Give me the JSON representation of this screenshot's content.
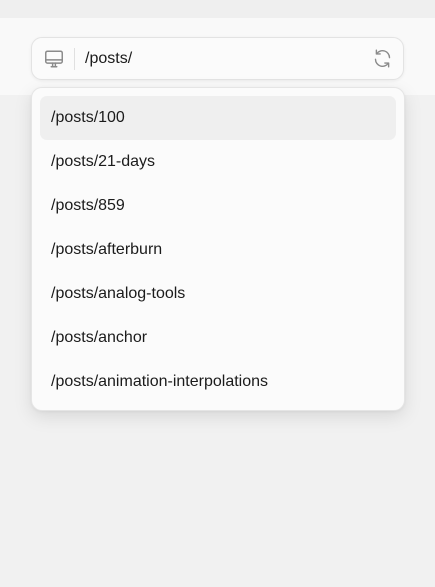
{
  "url_bar": {
    "value": "/posts/",
    "device_icon": "monitor-icon",
    "reload_icon": "refresh-icon"
  },
  "suggestions": [
    {
      "label": "/posts/100",
      "highlighted": true
    },
    {
      "label": "/posts/21-days",
      "highlighted": false
    },
    {
      "label": "/posts/859",
      "highlighted": false
    },
    {
      "label": "/posts/afterburn",
      "highlighted": false
    },
    {
      "label": "/posts/analog-tools",
      "highlighted": false
    },
    {
      "label": "/posts/anchor",
      "highlighted": false
    },
    {
      "label": "/posts/animation-interpolations",
      "highlighted": false
    }
  ],
  "colors": {
    "background": "#f1f1f1",
    "surface": "#fbfbfb",
    "highlight": "#efefef",
    "text": "#1b1b1b",
    "icon": "#8a8a8a"
  }
}
